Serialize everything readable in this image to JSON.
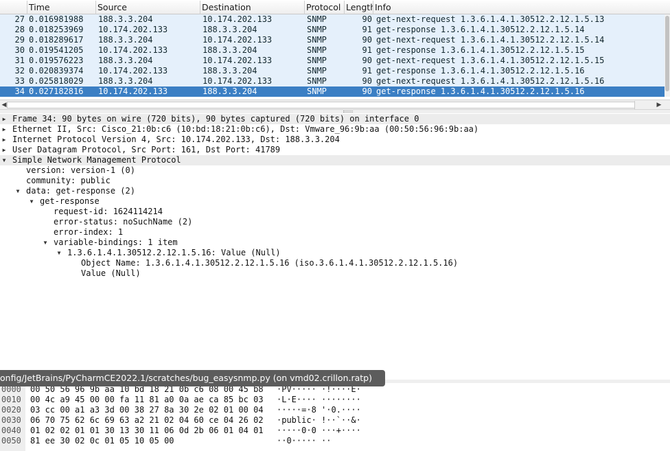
{
  "columns": [
    {
      "label": ""
    },
    {
      "label": "Time"
    },
    {
      "label": "Source"
    },
    {
      "label": "Destination"
    },
    {
      "label": "Protocol"
    },
    {
      "label": "Length"
    },
    {
      "label": "Info"
    }
  ],
  "packets": [
    {
      "no": "27",
      "time": "0.016981988",
      "src": "188.3.3.204",
      "dst": "10.174.202.133",
      "proto": "SNMP",
      "len": "90",
      "info": "get-next-request 1.3.6.1.4.1.30512.2.12.1.5.13"
    },
    {
      "no": "28",
      "time": "0.018253969",
      "src": "10.174.202.133",
      "dst": "188.3.3.204",
      "proto": "SNMP",
      "len": "91",
      "info": "get-response 1.3.6.1.4.1.30512.2.12.1.5.14"
    },
    {
      "no": "29",
      "time": "0.018289617",
      "src": "188.3.3.204",
      "dst": "10.174.202.133",
      "proto": "SNMP",
      "len": "90",
      "info": "get-next-request 1.3.6.1.4.1.30512.2.12.1.5.14"
    },
    {
      "no": "30",
      "time": "0.019541205",
      "src": "10.174.202.133",
      "dst": "188.3.3.204",
      "proto": "SNMP",
      "len": "91",
      "info": "get-response 1.3.6.1.4.1.30512.2.12.1.5.15"
    },
    {
      "no": "31",
      "time": "0.019576223",
      "src": "188.3.3.204",
      "dst": "10.174.202.133",
      "proto": "SNMP",
      "len": "90",
      "info": "get-next-request 1.3.6.1.4.1.30512.2.12.1.5.15"
    },
    {
      "no": "32",
      "time": "0.020839374",
      "src": "10.174.202.133",
      "dst": "188.3.3.204",
      "proto": "SNMP",
      "len": "91",
      "info": "get-response 1.3.6.1.4.1.30512.2.12.1.5.16"
    },
    {
      "no": "33",
      "time": "0.025818029",
      "src": "188.3.3.204",
      "dst": "10.174.202.133",
      "proto": "SNMP",
      "len": "90",
      "info": "get-next-request 1.3.6.1.4.1.30512.2.12.1.5.16"
    },
    {
      "no": "34",
      "time": "0.027182816",
      "src": "10.174.202.133",
      "dst": "188.3.3.204",
      "proto": "SNMP",
      "len": "90",
      "info": "get-response 1.3.6.1.4.1.30512.2.12.1.5.16"
    }
  ],
  "selected_packet": "34",
  "details": [
    {
      "level": 0,
      "toggle": "collapsed",
      "text": "Frame 34: 90 bytes on wire (720 bits), 90 bytes captured (720 bits) on interface 0",
      "highlight": true
    },
    {
      "level": 0,
      "toggle": "collapsed",
      "text": "Ethernet II, Src: Cisco_21:0b:c6 (10:bd:18:21:0b:c6), Dst: Vmware_96:9b:aa (00:50:56:96:9b:aa)",
      "highlight": false
    },
    {
      "level": 0,
      "toggle": "collapsed",
      "text": "Internet Protocol Version 4, Src: 10.174.202.133, Dst: 188.3.3.204",
      "highlight": false
    },
    {
      "level": 0,
      "toggle": "collapsed",
      "text": "User Datagram Protocol, Src Port: 161, Dst Port: 41789",
      "highlight": false
    },
    {
      "level": 0,
      "toggle": "expanded",
      "text": "Simple Network Management Protocol",
      "highlight": true
    },
    {
      "level": 1,
      "toggle": "none",
      "text": "version: version-1 (0)",
      "highlight": false
    },
    {
      "level": 1,
      "toggle": "none",
      "text": "community: public",
      "highlight": false
    },
    {
      "level": 1,
      "toggle": "expanded",
      "text": "data: get-response (2)",
      "highlight": false
    },
    {
      "level": 2,
      "toggle": "expanded",
      "text": "get-response",
      "highlight": false
    },
    {
      "level": 3,
      "toggle": "none",
      "text": "request-id: 1624114214",
      "highlight": false
    },
    {
      "level": 3,
      "toggle": "none",
      "text": "error-status: noSuchName (2)",
      "highlight": false
    },
    {
      "level": 3,
      "toggle": "none",
      "text": "error-index: 1",
      "highlight": false
    },
    {
      "level": 3,
      "toggle": "expanded",
      "text": "variable-bindings: 1 item",
      "highlight": false
    },
    {
      "level": 4,
      "toggle": "expanded",
      "text": "1.3.6.1.4.1.30512.2.12.1.5.16: Value (Null)",
      "highlight": false
    },
    {
      "level": 5,
      "toggle": "none",
      "text": "Object Name: 1.3.6.1.4.1.30512.2.12.1.5.16 (iso.3.6.1.4.1.30512.2.12.1.5.16)",
      "highlight": false
    },
    {
      "level": 5,
      "toggle": "none",
      "text": "Value (Null)",
      "highlight": false
    }
  ],
  "tooltip": {
    "text": "onfig/JetBrains/PyCharmCE2022.1/scratches/bug_easysnmp.py (on vmd02.crillon.ratp)"
  },
  "bytes": [
    {
      "offset": "0000",
      "hex": "00 50 56 96 9b aa 10 bd  18 21 0b c6 08 00 45 b8",
      "ascii": "·PV····· ·!····E·"
    },
    {
      "offset": "0010",
      "hex": "00 4c a9 45 00 00 fa 11  81 a0 0a ae ca 85 bc 03",
      "ascii": "·L·E···· ········"
    },
    {
      "offset": "0020",
      "hex": "03 cc 00 a1 a3 3d 00 38  27 8a 30 2e 02 01 00 04",
      "ascii": "·····=·8 '·0.····"
    },
    {
      "offset": "0030",
      "hex": "06 70 75 62 6c 69 63 a2  21 02 04 60 ce 04 26 02",
      "ascii": "·public· !··`··&·"
    },
    {
      "offset": "0040",
      "hex": "01 02 02 01 01 30 13 30  11 06 0d 2b 06 01 04 01",
      "ascii": "·····0·0 ···+····"
    },
    {
      "offset": "0050",
      "hex": "81 ee 30 02 0c 01 05 10  05 00",
      "ascii": "··0····· ··"
    }
  ],
  "colors": {
    "row_bg": "#e5f0fb",
    "selected_bg": "#3b7fc4",
    "highlight_bg": "#ececec",
    "tooltip_bg": "#5c5c5c"
  },
  "icons": {
    "collapsed": "triangle-right-icon",
    "expanded": "triangle-down-icon"
  }
}
